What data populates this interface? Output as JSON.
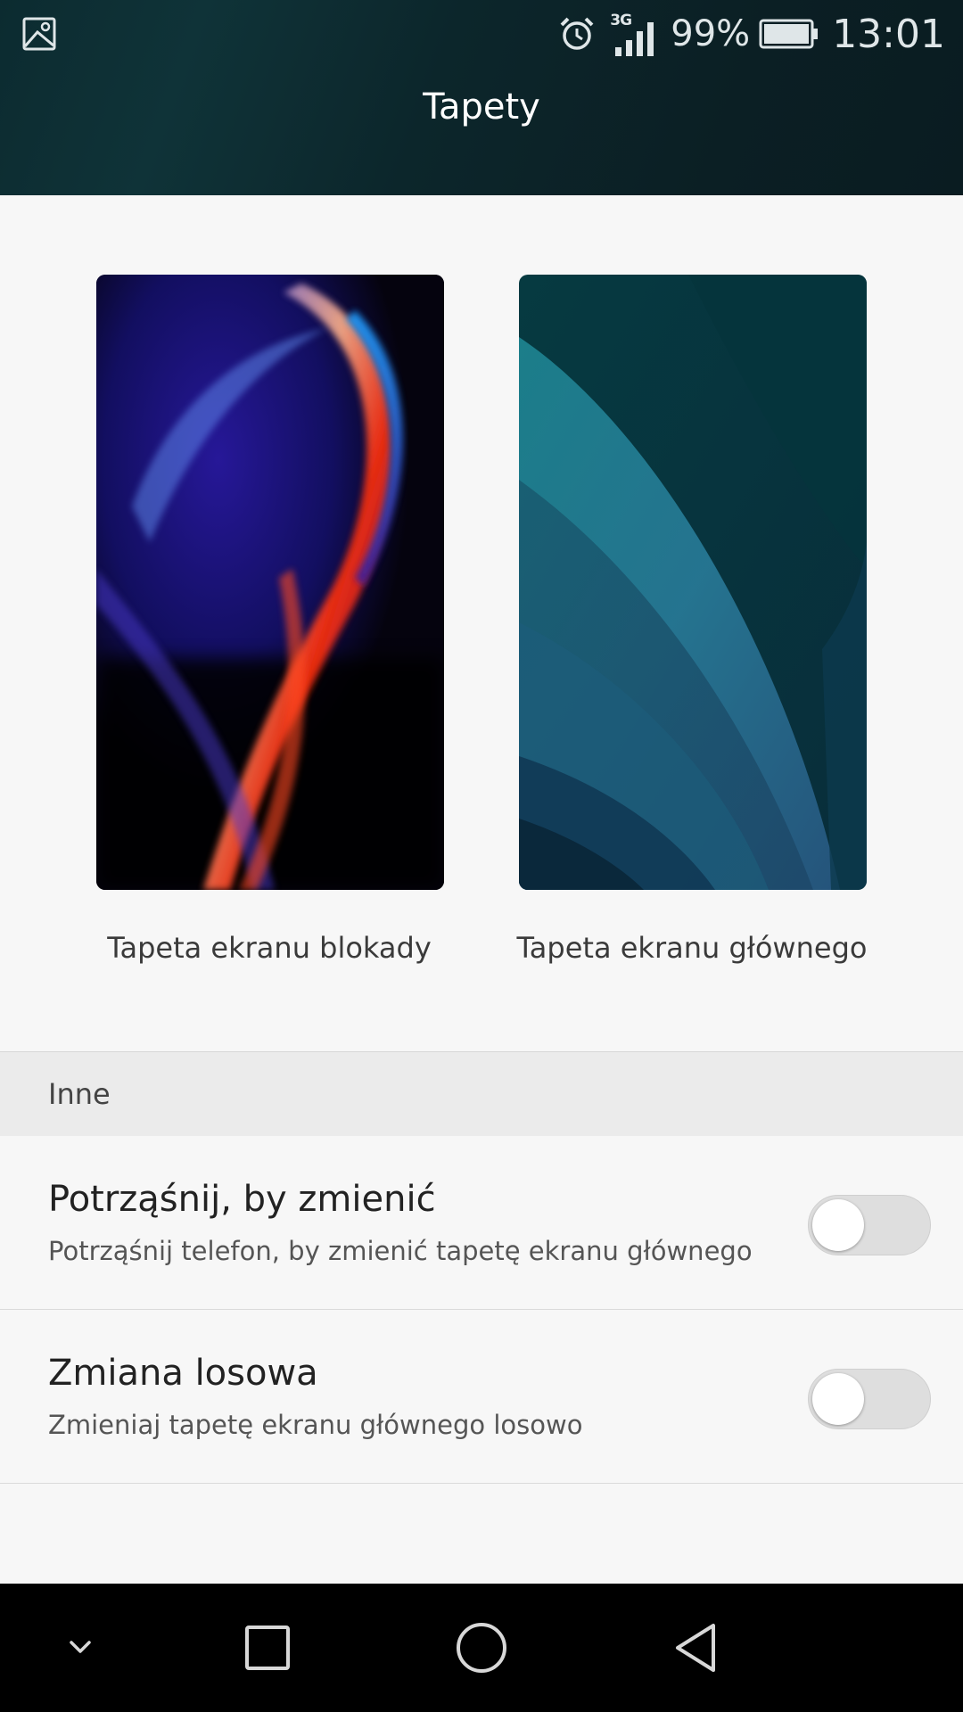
{
  "status_bar": {
    "network_type": "3G",
    "battery_percent": "99%",
    "time": "13:01"
  },
  "header": {
    "title": "Tapety"
  },
  "wallpapers": [
    {
      "label": "Tapeta ekranu blokady"
    },
    {
      "label": "Tapeta ekranu głównego"
    }
  ],
  "section": {
    "title": "Inne"
  },
  "settings": [
    {
      "title": "Potrząśnij, by zmienić",
      "subtitle": "Potrząśnij telefon, by zmienić tapetę ekranu głównego",
      "enabled": false
    },
    {
      "title": "Zmiana losowa",
      "subtitle": "Zmieniaj tapetę ekranu głównego losowo",
      "enabled": false
    }
  ],
  "nav_bar": {
    "buttons": [
      "notification-pull-down",
      "recent-apps",
      "home",
      "back"
    ]
  },
  "colors": {
    "header_bg": "#0c262b",
    "page_bg": "#f7f7f7",
    "section_bg": "#ebebeb",
    "nav_bg": "#000000"
  }
}
